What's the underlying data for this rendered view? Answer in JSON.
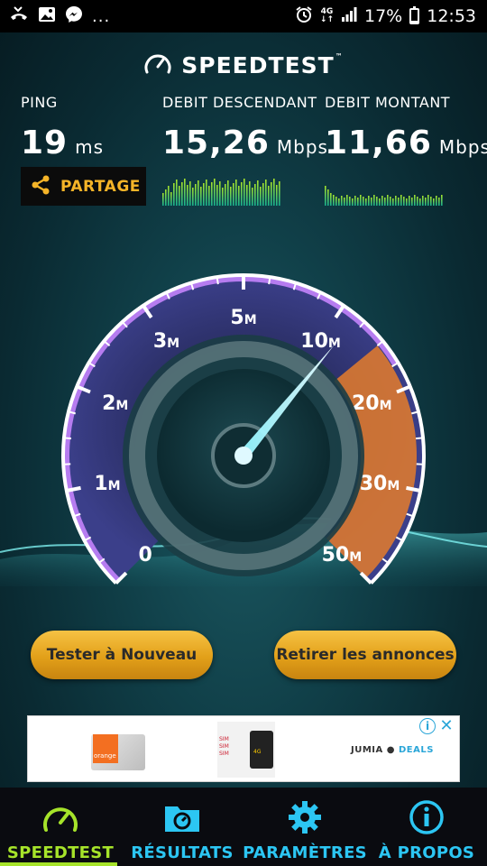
{
  "status_bar": {
    "left_icons": [
      "missed-call-icon",
      "image-icon",
      "messenger-icon",
      "more-dots-icon"
    ],
    "more": "...",
    "network": "4G",
    "battery_percent": "17%",
    "battery_level": 0.17,
    "time": "12:53"
  },
  "header": {
    "title": "SPEEDTEST",
    "trademark": "™"
  },
  "metrics": {
    "ping": {
      "label": "PING",
      "value": "19",
      "unit": "ms"
    },
    "download": {
      "label": "DEBIT DESCENDANT",
      "value": "15,26",
      "unit": "Mbps"
    },
    "upload": {
      "label": "DEBIT MONTANT",
      "value": "11,66",
      "unit": "Mbps"
    }
  },
  "share": {
    "label": "PARTAGE"
  },
  "gauge": {
    "ticks": [
      {
        "num": "0",
        "suffix": ""
      },
      {
        "num": "1",
        "suffix": "M"
      },
      {
        "num": "2",
        "suffix": "M"
      },
      {
        "num": "3",
        "suffix": "M"
      },
      {
        "num": "5",
        "suffix": "M"
      },
      {
        "num": "10",
        "suffix": "M"
      },
      {
        "num": "20",
        "suffix": "M"
      },
      {
        "num": "30",
        "suffix": "M"
      },
      {
        "num": "50",
        "suffix": "M"
      }
    ],
    "needle_value_mbps": 11.66
  },
  "buttons": {
    "retest": "Tester à Nouveau",
    "remove_ads": "Retirer les annonces"
  },
  "ad": {
    "sim_brand": "orange",
    "mid_lines": [
      "SIM",
      "SIM",
      "SIM",
      "4G"
    ],
    "brand": "JUMIA",
    "brand_accent": "DEALS",
    "info": "i",
    "close": "✕"
  },
  "nav": {
    "items": [
      {
        "label": "SPEEDTEST",
        "icon": "gauge-icon",
        "active": true
      },
      {
        "label": "RÉSULTATS",
        "icon": "results-folder-icon",
        "active": false
      },
      {
        "label": "PARAMÈTRES",
        "icon": "gear-icon",
        "active": false
      },
      {
        "label": "À PROPOS",
        "icon": "info-icon",
        "active": false
      }
    ]
  },
  "colors": {
    "accent_green": "#a6e32a",
    "accent_blue": "#2cc6f3",
    "share_orange": "#f5b428",
    "button_gold": "#e2a019",
    "gauge_purple": "#b67cf0",
    "gauge_orange": "#e57c2c"
  }
}
